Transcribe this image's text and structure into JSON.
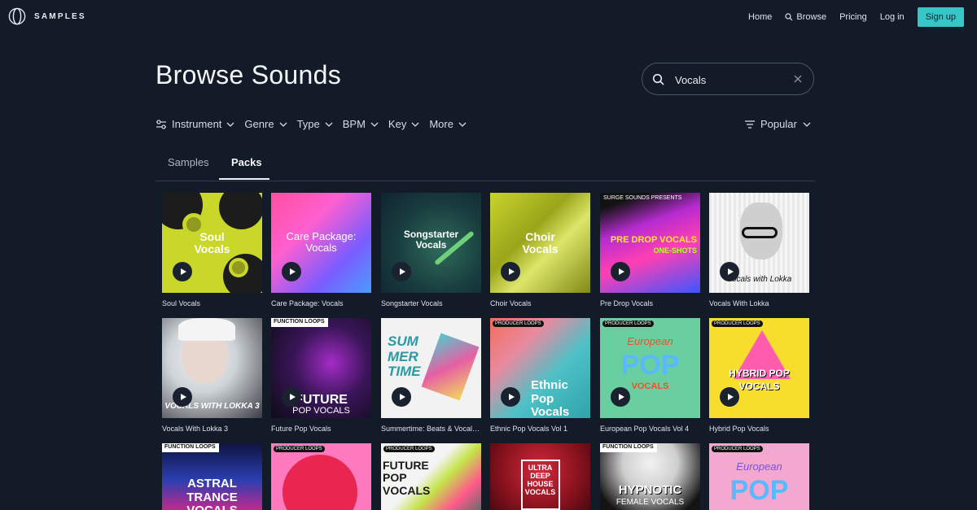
{
  "brand": {
    "name": "SAMPLES"
  },
  "nav": {
    "home": "Home",
    "browse": "Browse",
    "pricing": "Pricing",
    "login": "Log in",
    "signup": "Sign up"
  },
  "page": {
    "title": "Browse Sounds"
  },
  "search": {
    "value": "Vocals"
  },
  "filters": {
    "instrument": "Instrument",
    "genre": "Genre",
    "type": "Type",
    "bpm": "BPM",
    "key": "Key",
    "more": "More",
    "sort": "Popular"
  },
  "tabs": {
    "samples": "Samples",
    "packs": "Packs"
  },
  "packs": [
    {
      "title": "Soul Vocals",
      "cover_text": "Soul\nVocals"
    },
    {
      "title": "Care Package: Vocals",
      "cover_text": "Care Package:\nVocals"
    },
    {
      "title": "Songstarter Vocals",
      "cover_text": "Songstarter\nVocals"
    },
    {
      "title": "Choir Vocals",
      "cover_text": "Choir\nVocals"
    },
    {
      "title": "Pre Drop Vocals",
      "cover_text": "PRE DROP VOCALS",
      "cover_sub": "ONE-SHOTS",
      "cover_top": "SURGE SOUNDS PRESENTS"
    },
    {
      "title": "Vocals With Lokka",
      "cover_text": "Vocals with Lokka"
    },
    {
      "title": "Vocals With Lokka 3",
      "cover_text": "VOCALS WITH LOKKA 3"
    },
    {
      "title": "Future Pop Vocals",
      "cover_text": "FUTURE",
      "cover_sub": "POP VOCALS",
      "cover_top": "FUNCTION LOOPS"
    },
    {
      "title": "Summertime: Beats & Vocals ...",
      "cover_text": "SUM MER TIME"
    },
    {
      "title": "Ethnic Pop Vocals Vol 1",
      "cover_text": "Ethnic Pop Vocals",
      "cover_top": "PRODUCER LOOPS"
    },
    {
      "title": "European Pop Vocals Vol 4",
      "cover_text": "POP",
      "cover_sub": "VOCALS",
      "cover_top": "PRODUCER LOOPS",
      "cover_script": "European"
    },
    {
      "title": "Hybrid Pop Vocals",
      "cover_text": "HYBRID POP",
      "cover_sub": "VOCALS",
      "cover_top": "PRODUCER LOOPS"
    },
    {
      "title": "",
      "cover_text": "ASTRAL TRANCE VOCALS",
      "cover_top": "FUNCTION LOOPS"
    },
    {
      "title": "",
      "cover_text": "",
      "cover_top": "PRODUCER LOOPS"
    },
    {
      "title": "",
      "cover_text": "FUTURE POP VOCALS",
      "cover_top": "PRODUCER LOOPS"
    },
    {
      "title": "",
      "cover_text": "ULTRA DEEP HOUSE VOCALS"
    },
    {
      "title": "",
      "cover_text": "HYPNOTIC",
      "cover_sub": "FEMALE VOCALS",
      "cover_top": "FUNCTION LOOPS"
    },
    {
      "title": "",
      "cover_text": "POP",
      "cover_top": "PRODUCER LOOPS",
      "cover_script": "European"
    }
  ],
  "colors": {
    "background": "#131b28",
    "accent": "#36c6c6"
  }
}
